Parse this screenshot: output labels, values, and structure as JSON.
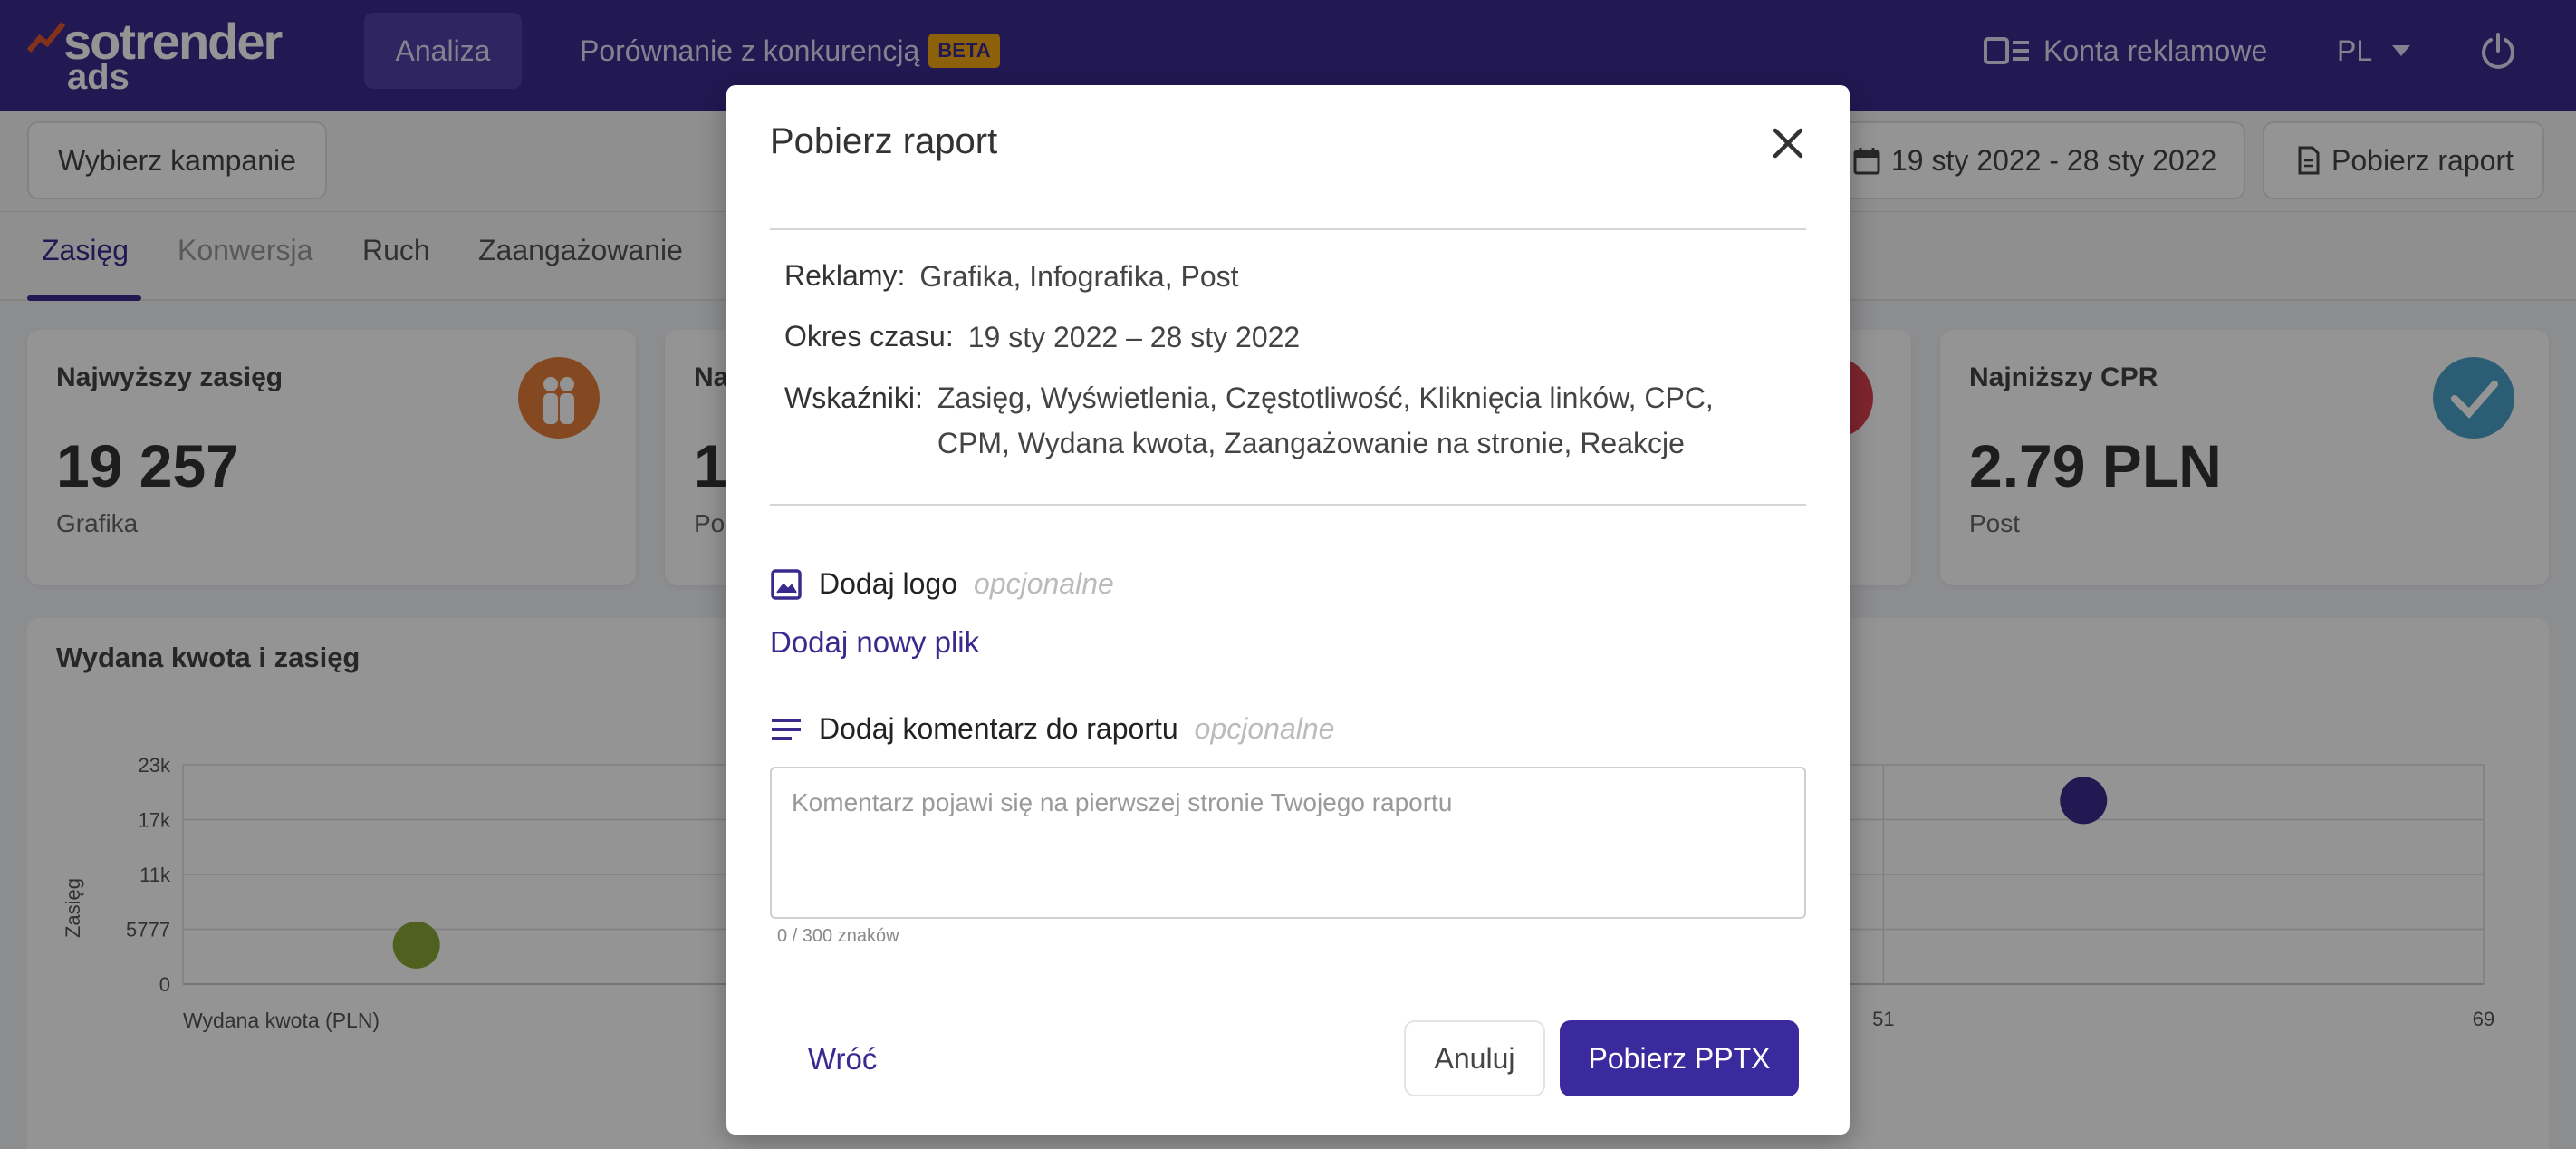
{
  "app": {
    "logo_main": "sotrender",
    "logo_sub": "ads"
  },
  "nav": {
    "analysis_label": "Analiza",
    "compare_label": "Porównanie z konkurencją",
    "beta_badge": "BETA",
    "accounts_label": "Konta reklamowe",
    "language": "PL"
  },
  "toolbar": {
    "select_campaigns_label": "Wybierz kampanie",
    "date_range": "19 sty 2022 - 28 sty 2022",
    "download_report_label": "Pobierz raport"
  },
  "tabs": [
    {
      "label": "Zasięg"
    },
    {
      "label": "Konwersja"
    },
    {
      "label": "Ruch"
    },
    {
      "label": "Zaangażowanie"
    }
  ],
  "cards": [
    {
      "title": "Najwyższy zasięg",
      "value": "19 257",
      "subtitle": "Grafika"
    },
    {
      "title": "Na",
      "value": "1",
      "subtitle": "Po"
    },
    {
      "title": "Najniższy CPR",
      "value": "2.79 PLN",
      "subtitle": "Post"
    }
  ],
  "chart_data": {
    "type": "scatter",
    "title": "Wydana kwota i zasięg",
    "xlabel": "Wydana kwota (PLN)",
    "ylabel": "Zasięg",
    "yticks": [
      "23k",
      "17k",
      "11k",
      "5777",
      "0"
    ],
    "xticks_visible": [
      "51",
      "69"
    ],
    "ylim": [
      0,
      23000
    ],
    "points": [
      {
        "x": 7,
        "y": 4100,
        "color": "#8aa836"
      },
      {
        "x": 57,
        "y": 19257,
        "color": "#3b2a8e"
      }
    ]
  },
  "modal": {
    "title": "Pobierz raport",
    "ads_label": "Reklamy:",
    "ads_value": "Grafika, Infografika, Post",
    "period_label": "Okres czasu:",
    "period_value": "19 sty 2022 – 28 sty 2022",
    "metrics_label": "Wskaźniki:",
    "metrics_value": "Zasięg, Wyświetlenia, Częstotliwość, Kliknięcia linków, CPC, CPM, Wydana kwota, Zaangażowanie na stronie, Reakcje",
    "logo_section_label": "Dodaj logo",
    "optional": "opcjonalne",
    "add_file_label": "Dodaj nowy plik",
    "comment_section_label": "Dodaj komentarz do raportu",
    "comment_value": "",
    "comment_placeholder": "Komentarz pojawi się na pierwszej stronie Twojego raportu",
    "char_counter": "0 / 300 znaków",
    "back_label": "Wróć",
    "cancel_label": "Anuluj",
    "download_pptx_label": "Pobierz PPTX"
  },
  "colors": {
    "brand": "#3b2a8e",
    "beta": "#f3a712",
    "card_icon_orange": "#e67e3c",
    "card_icon_blue": "#4aa3c8",
    "card_icon_red": "#d94050"
  }
}
